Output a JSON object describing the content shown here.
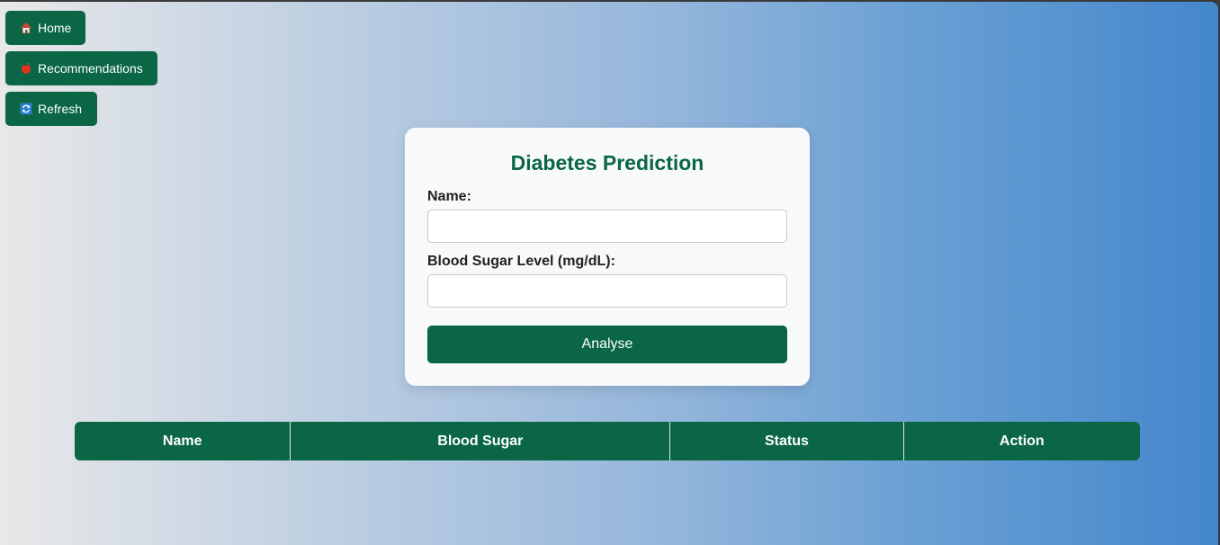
{
  "nav": {
    "home_label": "Home",
    "recommendations_label": "Recommendations",
    "refresh_label": "Refresh"
  },
  "icons": {
    "home": "house-icon",
    "recommendations": "apple-icon",
    "refresh": "refresh-icon"
  },
  "form": {
    "title": "Diabetes Prediction",
    "name_label": "Name:",
    "name_value": "",
    "sugar_label": "Blood Sugar Level (mg/dL):",
    "sugar_value": "",
    "submit_label": "Analyse"
  },
  "table": {
    "columns": [
      "Name",
      "Blood Sugar",
      "Status",
      "Action"
    ],
    "rows": []
  },
  "colors": {
    "primary": "#0a6645",
    "gradient_start": "#e8e8e8",
    "gradient_end": "#4487cc",
    "card_background": "#f7f9fb"
  }
}
